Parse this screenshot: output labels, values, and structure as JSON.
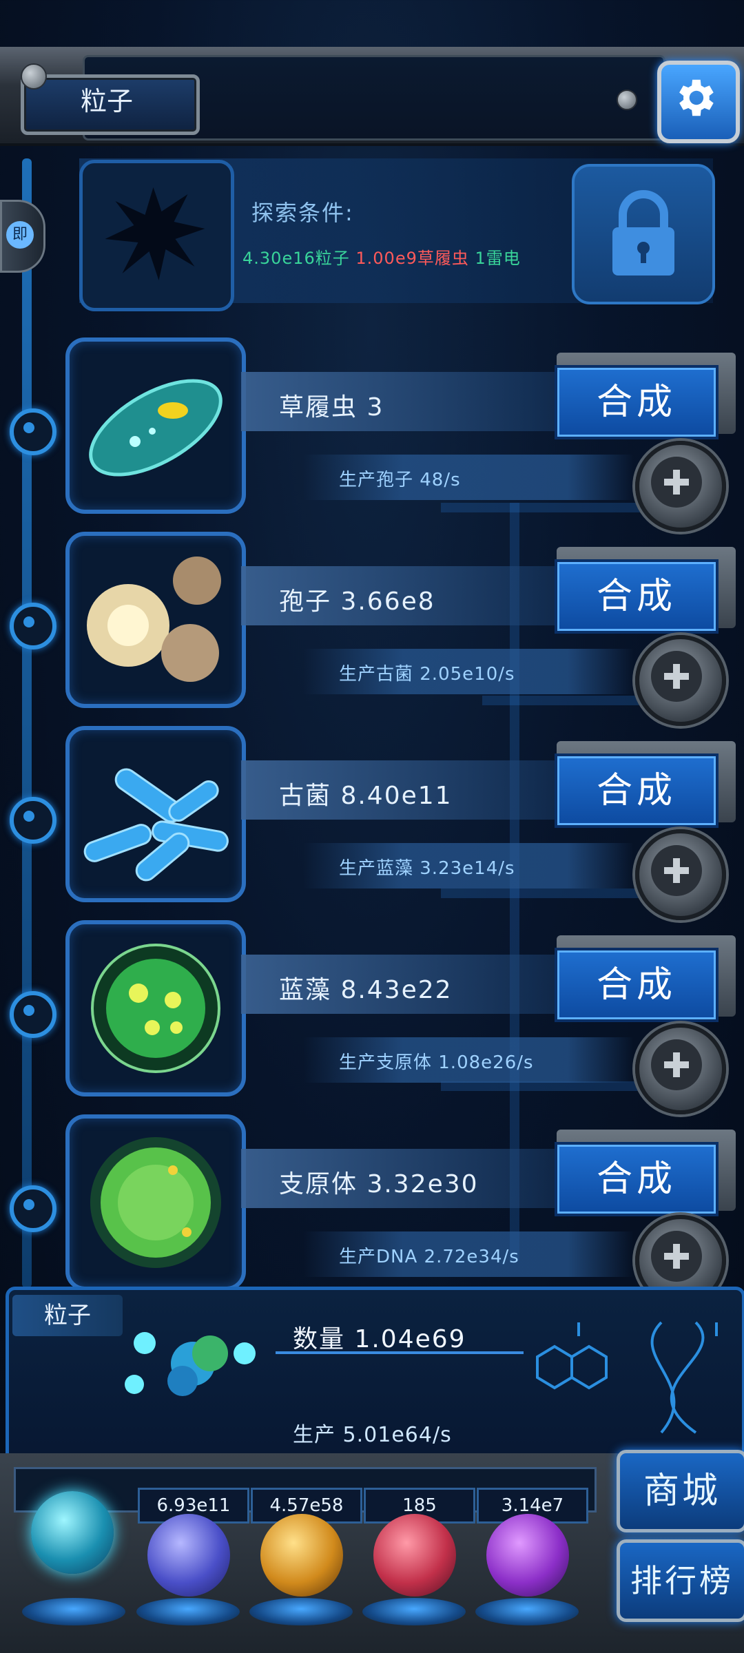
{
  "header": {
    "title": "粒子"
  },
  "side_tab_label": "即",
  "explore": {
    "label": "探索条件:",
    "requirements": [
      {
        "text": "4.30e16粒子",
        "color": "#39d59a"
      },
      {
        "text": "1.00e9草履虫",
        "color": "#ff6060"
      },
      {
        "text": "1雷电",
        "color": "#39d59a"
      }
    ]
  },
  "rows": [
    {
      "name": "草履虫 3",
      "produce": "生产孢子 48/s",
      "combine": "合成"
    },
    {
      "name": "孢子 3.66e8",
      "produce": "生产古菌 2.05e10/s",
      "combine": "合成"
    },
    {
      "name": "古菌 8.40e11",
      "produce": "生产蓝藻 3.23e14/s",
      "combine": "合成"
    },
    {
      "name": "蓝藻 8.43e22",
      "produce": "生产支原体 1.08e26/s",
      "combine": "合成"
    },
    {
      "name": "支原体 3.32e30",
      "produce": "生产DNA 2.72e34/s",
      "combine": "合成"
    }
  ],
  "bottom": {
    "label": "粒子",
    "quantity": "数量 1.04e69",
    "production": "生产 5.01e64/s"
  },
  "dock": {
    "counters": [
      "6.93e11",
      "4.57e58",
      "185",
      "3.14e7"
    ],
    "shop_label": "商城",
    "rank_label": "排行榜"
  },
  "colors": {
    "accent": "#2b6fbf",
    "button": "#1f6fd0",
    "green_text": "#39d59a",
    "red_text": "#ff6060"
  }
}
